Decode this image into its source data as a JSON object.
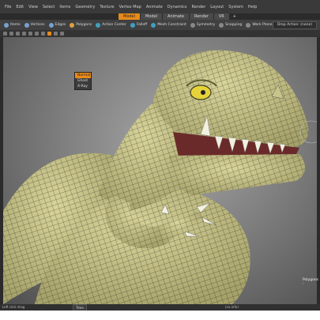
{
  "menu": [
    "File",
    "Edit",
    "View",
    "Select",
    "Items",
    "Geometry",
    "Texture",
    "Vertex Map",
    "Animate",
    "Dynamics",
    "Render",
    "Layout",
    "System",
    "Help"
  ],
  "mode_tabs": [
    {
      "label": "Model",
      "active": true
    },
    {
      "label": "Model",
      "active": false
    },
    {
      "label": "Animate",
      "active": false
    },
    {
      "label": "Render",
      "active": false
    },
    {
      "label": "VR",
      "active": false
    }
  ],
  "mode_tabs_add": "+",
  "toolbar": {
    "items": [
      {
        "label": "Items",
        "icon": "items-icon",
        "color": "#7aa0d0"
      },
      {
        "label": "Vertices",
        "icon": "vertices-icon",
        "color": "#7aa0d0"
      },
      {
        "label": "Edges",
        "icon": "edges-icon",
        "color": "#7aa0d0"
      },
      {
        "label": "Polygons",
        "icon": "polygons-icon",
        "color": "#e0a040"
      },
      {
        "label": "Action Center",
        "icon": "action-center-icon",
        "color": "#40a0c0"
      },
      {
        "label": "Falloff",
        "icon": "falloff-icon",
        "color": "#40a0c0"
      },
      {
        "label": "Mesh Constraint",
        "icon": "mesh-constraint-icon",
        "color": "#40a0c0"
      },
      {
        "label": "Symmetry",
        "icon": "symmetry-icon",
        "color": "#888888"
      },
      {
        "label": "Snapping",
        "icon": "snapping-icon",
        "color": "#888888"
      },
      {
        "label": "Work Plane",
        "icon": "work-plane-icon",
        "color": "#888888"
      }
    ],
    "drop_action": "Drop Action: (none)"
  },
  "shading_menu": {
    "options": [
      "Normal",
      "Ghost",
      "X-Ray"
    ],
    "selected": "Normal"
  },
  "hud": {
    "selection_label": "Polygons :"
  },
  "status": {
    "left": "Left click drag",
    "button": "Time",
    "mid": "(no info)"
  },
  "colors": {
    "accent": "#e88a1a",
    "skin": "#c8c48a",
    "eye": "#e6d33a",
    "teeth": "#f2f0e0"
  }
}
